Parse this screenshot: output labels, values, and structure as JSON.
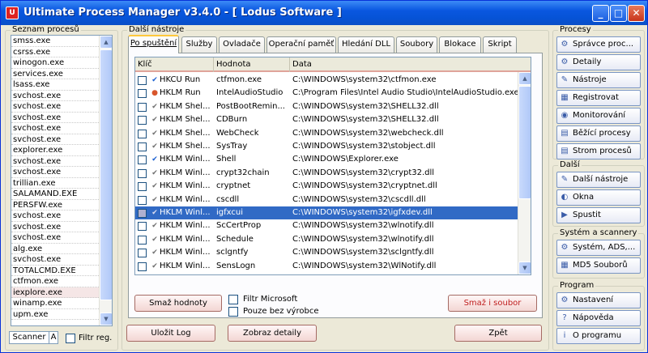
{
  "window": {
    "title": "Ultimate Process Manager v3.4.0 - [ Lodus Software ]",
    "minimize": "_",
    "maximize": "□",
    "close": "✕"
  },
  "process_panel": {
    "title": "Seznam procesů",
    "processes": [
      "smss.exe",
      "csrss.exe",
      "winogon.exe",
      "services.exe",
      "lsass.exe",
      "svchost.exe",
      "svchost.exe",
      "svchost.exe",
      "svchost.exe",
      "svchost.exe",
      "explorer.exe",
      "svchost.exe",
      "svchost.exe",
      "trillian.exe",
      "SALAMAND.EXE",
      "PERSFW.exe",
      "svchost.exe",
      "svchost.exe",
      "svchost.exe",
      "alg.exe",
      "svchost.exe",
      "TOTALCMD.EXE",
      "ctfmon.exe",
      "iexplore.exe",
      "winamp.exe",
      "upm.exe"
    ],
    "selected_index": 23,
    "scanner_label": "Scanner",
    "scanner_suffix": "A",
    "filter_label": "Filtr reg."
  },
  "tools_panel": {
    "title": "Další nástroje",
    "tabs": [
      "Po spuštění",
      "Služby",
      "Ovladače",
      "Operační paměť",
      "Hledání DLL",
      "Soubory",
      "Blokace",
      "Skript"
    ],
    "active_tab": 0,
    "columns": [
      "Klíč",
      "Hodnota",
      "Data"
    ],
    "rows": [
      {
        "key": "HKCU Run",
        "value": "ctfmon.exe",
        "data": "C:\\WINDOWS\\system32\\ctfmon.exe",
        "indicator": "check-blue"
      },
      {
        "key": "HKLM Run",
        "value": "IntelAudioStudio",
        "data": "C:\\Program Files\\Intel Audio Studio\\IntelAudioStudio.exe",
        "indicator": "dot-red"
      },
      {
        "key": "HKLM Shel...",
        "value": "PostBootRemin...",
        "data": "C:\\WINDOWS\\system32\\SHELL32.dll",
        "indicator": "check-gray"
      },
      {
        "key": "HKLM Shel...",
        "value": "CDBurn",
        "data": "C:\\WINDOWS\\system32\\SHELL32.dll",
        "indicator": "check-gray"
      },
      {
        "key": "HKLM Shel...",
        "value": "WebCheck",
        "data": "C:\\WINDOWS\\system32\\webcheck.dll",
        "indicator": "check-gray"
      },
      {
        "key": "HKLM Shel...",
        "value": "SysTray",
        "data": "C:\\WINDOWS\\system32\\stobject.dll",
        "indicator": "check-gray"
      },
      {
        "key": "HKLM Winl...",
        "value": "Shell",
        "data": "C:\\WINDOWS\\Explorer.exe",
        "indicator": "check-blue"
      },
      {
        "key": "HKLM Winl...",
        "value": "crypt32chain",
        "data": "C:\\WINDOWS\\system32\\crypt32.dll",
        "indicator": "check-gray"
      },
      {
        "key": "HKLM Winl...",
        "value": "cryptnet",
        "data": "C:\\WINDOWS\\system32\\cryptnet.dll",
        "indicator": "check-gray"
      },
      {
        "key": "HKLM Winl...",
        "value": "cscdll",
        "data": "C:\\WINDOWS\\system32\\cscdll.dll",
        "indicator": "check-gray"
      },
      {
        "key": "HKLM Winl...",
        "value": "igfxcui",
        "data": "C:\\WINDOWS\\system32\\igfxdev.dll",
        "indicator": "check-gray"
      },
      {
        "key": "HKLM Winl...",
        "value": "ScCertProp",
        "data": "C:\\WINDOWS\\system32\\wlnotify.dll",
        "indicator": "check-gray"
      },
      {
        "key": "HKLM Winl...",
        "value": "Schedule",
        "data": "C:\\WINDOWS\\system32\\wlnotify.dll",
        "indicator": "check-gray"
      },
      {
        "key": "HKLM Winl...",
        "value": "sclgntfy",
        "data": "C:\\WINDOWS\\system32\\sclgntfy.dll",
        "indicator": "check-gray"
      },
      {
        "key": "HKLM Winl...",
        "value": "SensLogn",
        "data": "C:\\WINDOWS\\system32\\WlNotify.dll",
        "indicator": "check-gray"
      }
    ],
    "selected_row": 10,
    "delete_values_button": "Smaž hodnoty",
    "filter_microsoft": "Filtr Microsoft",
    "only_without_vendor": "Pouze bez výrobce",
    "delete_file_button": "Smaž i soubor"
  },
  "bottom_buttons": {
    "save_log": "Uložit Log",
    "show_details": "Zobraz detaily",
    "back": "Zpět"
  },
  "right_panel": {
    "groups": [
      {
        "title": "Procesy",
        "items": [
          {
            "label": "Správce proc...",
            "icon": "⚙"
          },
          {
            "label": "Detaily",
            "icon": "⚙"
          },
          {
            "label": "Nástroje",
            "icon": "✎"
          },
          {
            "label": "Registrovat",
            "icon": "▦"
          },
          {
            "label": "Monitorování",
            "icon": "◉"
          },
          {
            "label": "Běžící procesy",
            "icon": "▤"
          },
          {
            "label": "Strom procesů",
            "icon": "▤"
          }
        ]
      },
      {
        "title": "Další",
        "items": [
          {
            "label": "Další nástroje",
            "icon": "✎"
          },
          {
            "label": "Okna",
            "icon": "◐"
          },
          {
            "label": "Spustit",
            "icon": "▶"
          }
        ]
      },
      {
        "title": "Systém a scannery",
        "items": [
          {
            "label": "Systém, ADS,...",
            "icon": "⚙"
          },
          {
            "label": "MD5 Souborů",
            "icon": "▦"
          }
        ]
      },
      {
        "title": "Program",
        "items": [
          {
            "label": "Nastavení",
            "icon": "⚙"
          },
          {
            "label": "Nápověda",
            "icon": "?"
          },
          {
            "label": "O programu",
            "icon": "i"
          }
        ]
      }
    ]
  },
  "colors": {
    "title_bar": "#0a57e0",
    "selection": "#316ac5",
    "pink_button": "#f3d6d3",
    "red_text": "#c02020"
  }
}
